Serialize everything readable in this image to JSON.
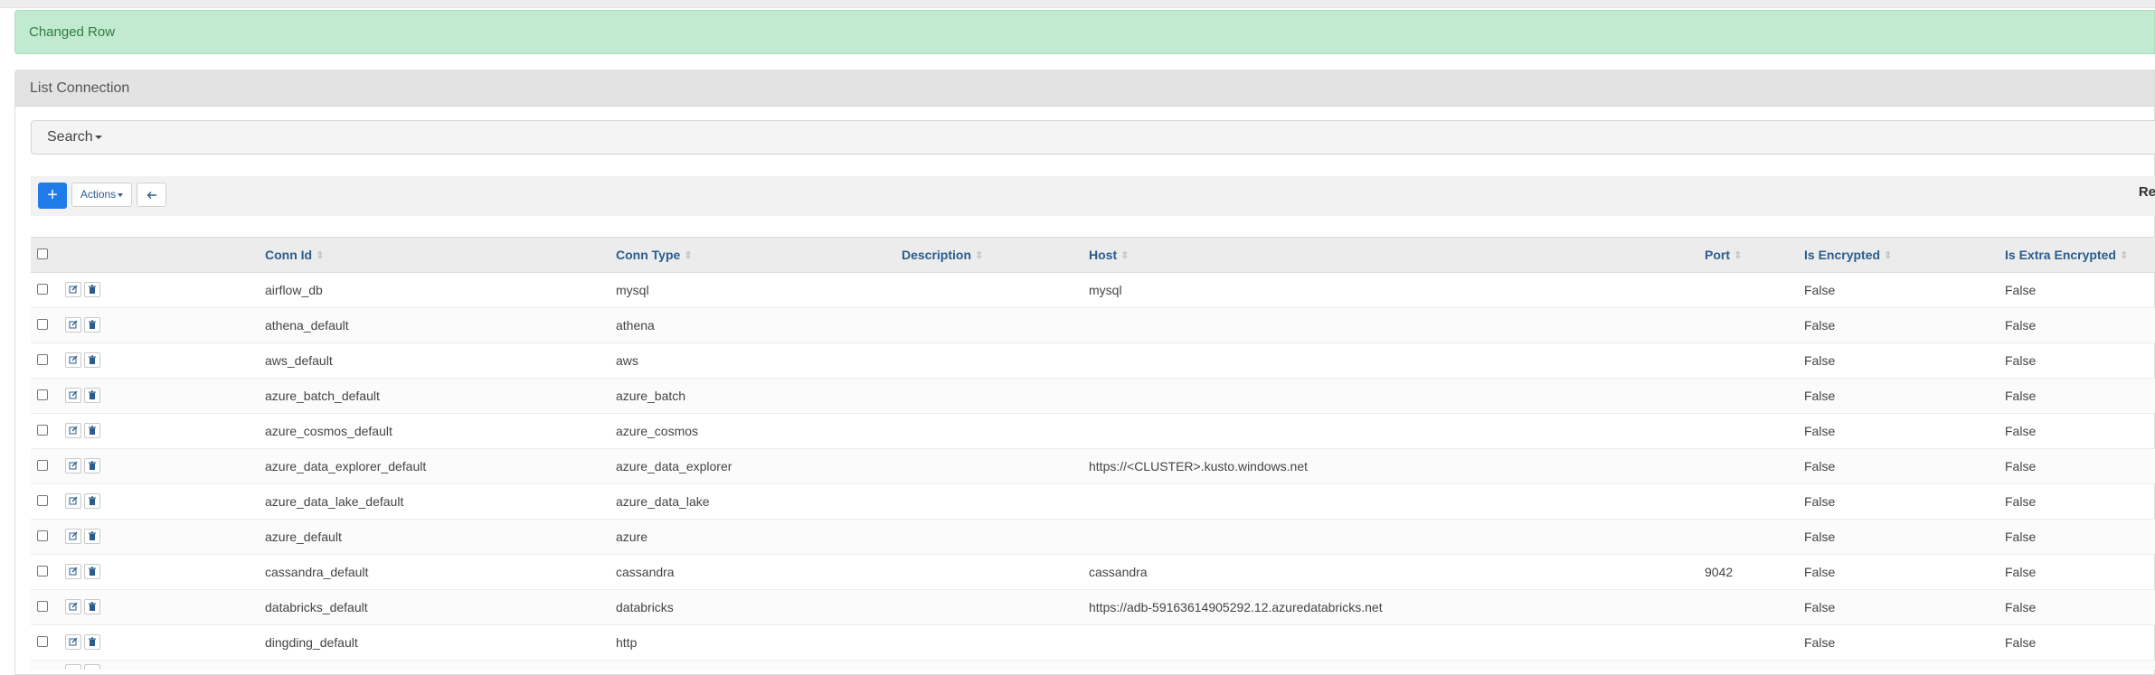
{
  "alert": {
    "message": "Changed Row"
  },
  "panel": {
    "title": "List Connection"
  },
  "search": {
    "label": "Search"
  },
  "toolbar": {
    "add_label": "+",
    "actions_label": "Actions",
    "back_icon": "arrow-left-icon",
    "record_count_label": "Re"
  },
  "table": {
    "columns": [
      "Conn Id",
      "Conn Type",
      "Description",
      "Host",
      "Port",
      "Is Encrypted",
      "Is Extra Encrypted"
    ],
    "rows": [
      {
        "conn_id": "airflow_db",
        "conn_type": "mysql",
        "description": "",
        "host": "mysql",
        "port": "",
        "is_encrypted": "False",
        "is_extra_encrypted": "False"
      },
      {
        "conn_id": "athena_default",
        "conn_type": "athena",
        "description": "",
        "host": "",
        "port": "",
        "is_encrypted": "False",
        "is_extra_encrypted": "False"
      },
      {
        "conn_id": "aws_default",
        "conn_type": "aws",
        "description": "",
        "host": "",
        "port": "",
        "is_encrypted": "False",
        "is_extra_encrypted": "False"
      },
      {
        "conn_id": "azure_batch_default",
        "conn_type": "azure_batch",
        "description": "",
        "host": "",
        "port": "",
        "is_encrypted": "False",
        "is_extra_encrypted": "False"
      },
      {
        "conn_id": "azure_cosmos_default",
        "conn_type": "azure_cosmos",
        "description": "",
        "host": "",
        "port": "",
        "is_encrypted": "False",
        "is_extra_encrypted": "False"
      },
      {
        "conn_id": "azure_data_explorer_default",
        "conn_type": "azure_data_explorer",
        "description": "",
        "host": "https://<CLUSTER>.kusto.windows.net",
        "port": "",
        "is_encrypted": "False",
        "is_extra_encrypted": "False"
      },
      {
        "conn_id": "azure_data_lake_default",
        "conn_type": "azure_data_lake",
        "description": "",
        "host": "",
        "port": "",
        "is_encrypted": "False",
        "is_extra_encrypted": "False"
      },
      {
        "conn_id": "azure_default",
        "conn_type": "azure",
        "description": "",
        "host": "",
        "port": "",
        "is_encrypted": "False",
        "is_extra_encrypted": "False"
      },
      {
        "conn_id": "cassandra_default",
        "conn_type": "cassandra",
        "description": "",
        "host": "cassandra",
        "port": "9042",
        "is_encrypted": "False",
        "is_extra_encrypted": "False"
      },
      {
        "conn_id": "databricks_default",
        "conn_type": "databricks",
        "description": "",
        "host": "https://adb-59163614905292.12.azuredatabricks.net",
        "port": "",
        "is_encrypted": "False",
        "is_extra_encrypted": "False"
      },
      {
        "conn_id": "dingding_default",
        "conn_type": "http",
        "description": "",
        "host": "",
        "port": "",
        "is_encrypted": "False",
        "is_extra_encrypted": "False"
      }
    ]
  },
  "colors": {
    "alert_bg": "#c1ead0",
    "alert_text": "#2f7d3f",
    "primary": "#1e7be7",
    "header_link": "#2a5d8e"
  }
}
